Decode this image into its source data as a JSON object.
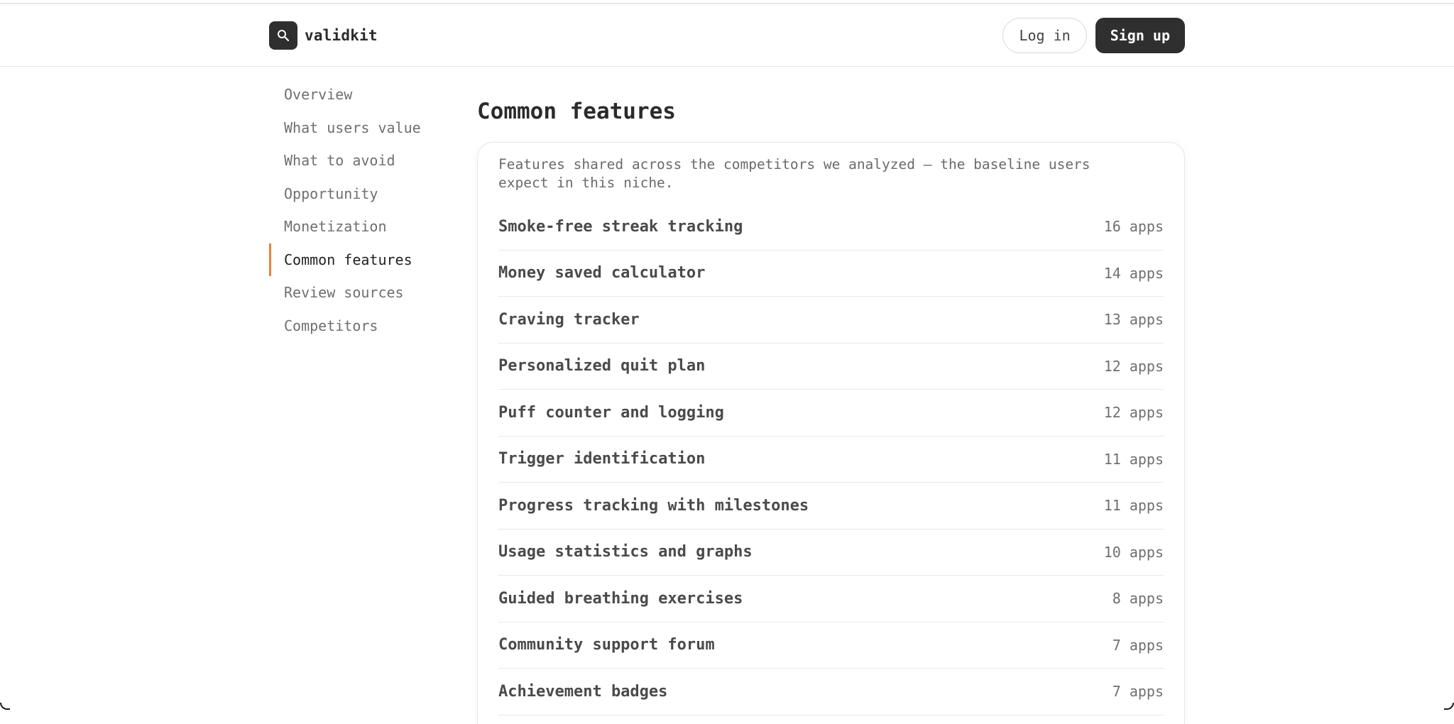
{
  "header": {
    "brand_name": "validkit",
    "logo_icon": "magnifier-icon",
    "login_label": "Log in",
    "signup_label": "Sign up"
  },
  "sidebar": {
    "items": [
      {
        "label": "Overview",
        "active": false
      },
      {
        "label": "What users value",
        "active": false
      },
      {
        "label": "What to avoid",
        "active": false
      },
      {
        "label": "Opportunity",
        "active": false
      },
      {
        "label": "Monetization",
        "active": false
      },
      {
        "label": "Common features",
        "active": true
      },
      {
        "label": "Review sources",
        "active": false
      },
      {
        "label": "Competitors",
        "active": false
      }
    ]
  },
  "main": {
    "title": "Common features",
    "description": "Features shared across the competitors we analyzed — the baseline users expect in this niche.",
    "features": [
      {
        "name": "Smoke-free streak tracking",
        "count": "16 apps"
      },
      {
        "name": "Money saved calculator",
        "count": "14 apps"
      },
      {
        "name": "Craving tracker",
        "count": "13 apps"
      },
      {
        "name": "Personalized quit plan",
        "count": "12 apps"
      },
      {
        "name": "Puff counter and logging",
        "count": "12 apps"
      },
      {
        "name": "Trigger identification",
        "count": "11 apps"
      },
      {
        "name": "Progress tracking with milestones",
        "count": "11 apps"
      },
      {
        "name": "Usage statistics and graphs",
        "count": "10 apps"
      },
      {
        "name": "Guided breathing exercises",
        "count": "8 apps"
      },
      {
        "name": "Community support forum",
        "count": "7 apps"
      },
      {
        "name": "Achievement badges",
        "count": "7 apps"
      }
    ]
  },
  "colors": {
    "accent": "#e8833a",
    "dark": "#2f2f2f"
  }
}
